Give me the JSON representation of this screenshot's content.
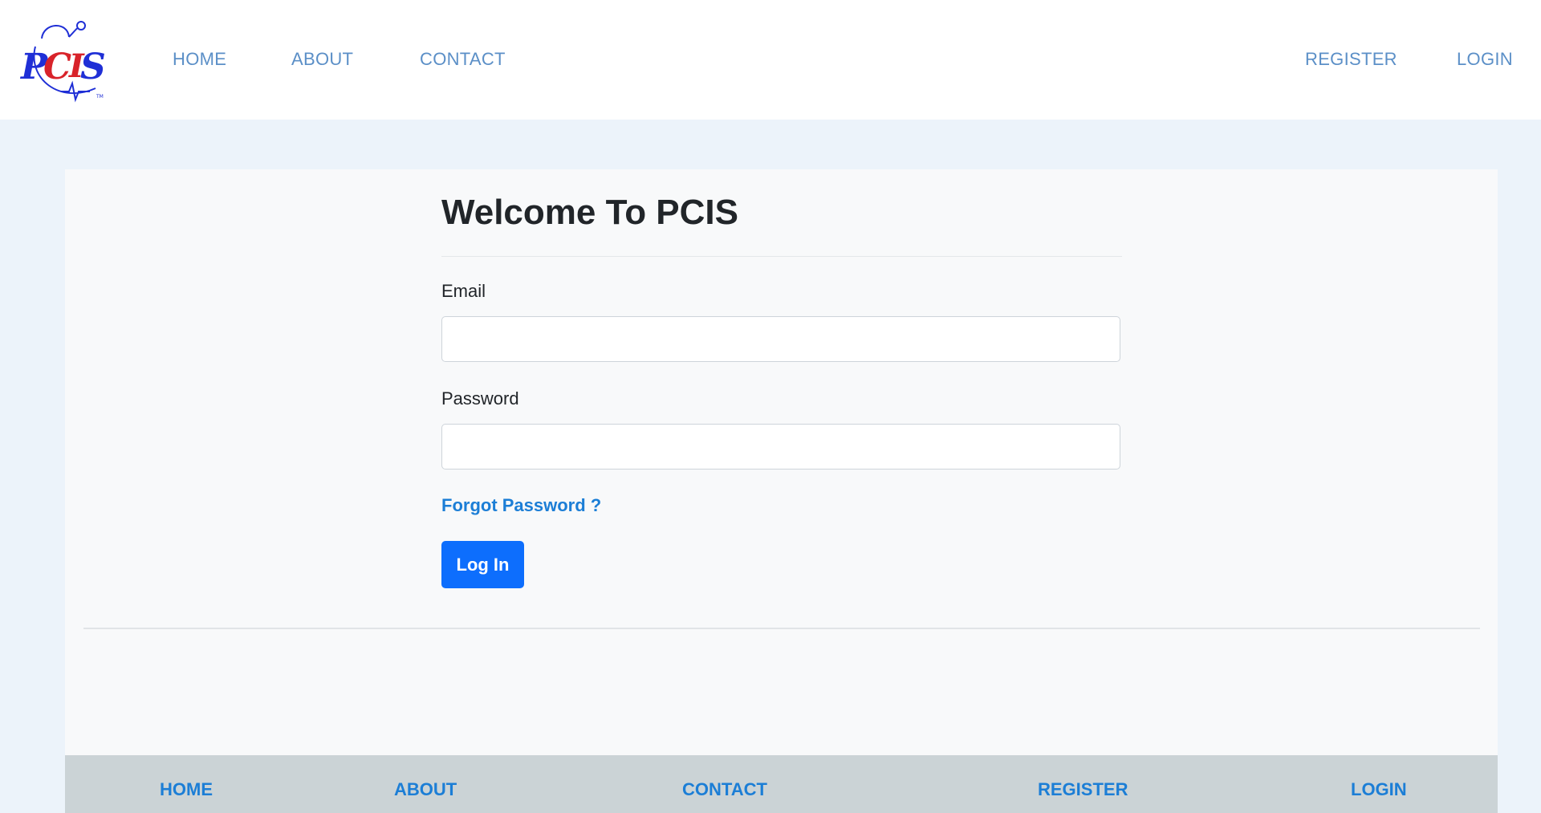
{
  "brand": {
    "logo_text": "PCIS",
    "trademark": "TM"
  },
  "topnav": {
    "home": "HOME",
    "about": "ABOUT",
    "contact": "CONTACT",
    "register": "REGISTER",
    "login": "LOGIN"
  },
  "login_form": {
    "title": "Welcome To PCIS",
    "email_label": "Email",
    "email_value": "",
    "password_label": "Password",
    "password_value": "",
    "forgot_password": "Forgot Password ?",
    "submit_label": "Log In"
  },
  "footer": {
    "home": "HOME",
    "about": "ABOUT",
    "contact": "CONTACT",
    "register": "REGISTER",
    "login": "LOGIN"
  },
  "colors": {
    "page_background": "#ecf3fa",
    "nav_link": "#5b8fc7",
    "link": "#1c7ed6",
    "primary_button": "#0d6efd",
    "footer_background": "#cbd3d6",
    "logo_blue": "#1f2fd6",
    "logo_red": "#d8232a"
  }
}
